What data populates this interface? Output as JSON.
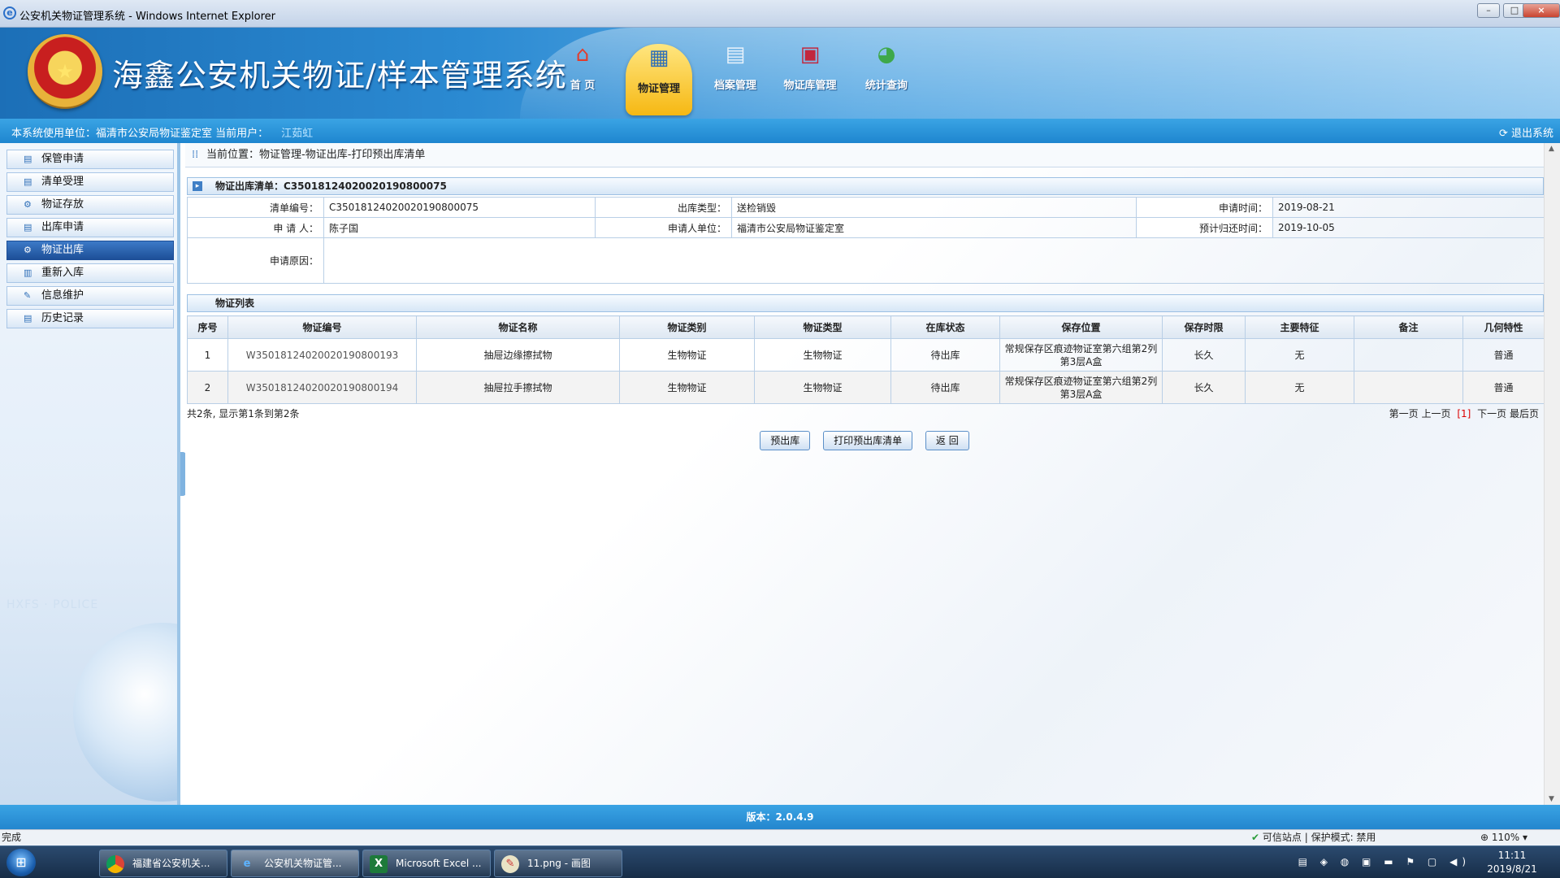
{
  "window": {
    "title": "公安机关物证管理系统 - Windows Internet Explorer"
  },
  "header": {
    "system_name": "海鑫公安机关物证/样本管理系统",
    "nav": [
      {
        "label": "首  页",
        "icon": "home-icon"
      },
      {
        "label": "物证管理",
        "icon": "calendar-icon"
      },
      {
        "label": "档案管理",
        "icon": "archive-icon"
      },
      {
        "label": "物证库管理",
        "icon": "warehouse-icon"
      },
      {
        "label": "统计查询",
        "icon": "chart-icon"
      }
    ],
    "active_nav": "物证管理"
  },
  "infobar": {
    "unit_text": "本系统使用单位：福清市公安局物证鉴定室 当前用户：",
    "user": "江茹虹",
    "logout": "退出系统"
  },
  "sidebar": {
    "items": [
      {
        "label": "保管申请"
      },
      {
        "label": "清单受理"
      },
      {
        "label": "物证存放"
      },
      {
        "label": "出库申请"
      },
      {
        "label": "物证出库"
      },
      {
        "label": "重新入库"
      },
      {
        "label": "信息维护"
      },
      {
        "label": "历史记录"
      }
    ],
    "active": "物证出库"
  },
  "breadcrumb": "当前位置：物证管理-物证出库-打印预出库清单",
  "detail": {
    "heading": "物证出库清单：C35018124020020190800075",
    "fields": {
      "list_no_label": "清单编号：",
      "list_no": "C35018124020020190800075",
      "out_type_label": "出库类型：",
      "out_type": "送检销毁",
      "apply_time_label": "申请时间：",
      "apply_time": "2019-08-21",
      "applicant_label": "申 请 人：",
      "applicant": "陈子国",
      "applicant_unit_label": "申请人单位：",
      "applicant_unit": "福清市公安局物证鉴定室",
      "return_time_label": "预计归还时间：",
      "return_time": "2019-10-05",
      "reason_label": "申请原因：",
      "reason": ""
    }
  },
  "evidence_list": {
    "heading": "物证列表",
    "columns": [
      "序号",
      "物证编号",
      "物证名称",
      "物证类别",
      "物证类型",
      "在库状态",
      "保存位置",
      "保存时限",
      "主要特征",
      "备注",
      "几何特性"
    ],
    "rows": [
      [
        "1",
        "W35018124020020190800193",
        "抽屉边缘擦拭物",
        "生物物证",
        "生物物证",
        "待出库",
        "常规保存区痕迹物证室第六组第2列第3层A盒",
        "长久",
        "无",
        "",
        "普通"
      ],
      [
        "2",
        "W35018124020020190800194",
        "抽屉拉手擦拭物",
        "生物物证",
        "生物物证",
        "待出库",
        "常规保存区痕迹物证室第六组第2列第3层A盒",
        "长久",
        "无",
        "",
        "普通"
      ]
    ],
    "summary": "共2条, 显示第1条到第2条",
    "pager": {
      "first": "第一页",
      "prev": "上一页",
      "current": "[1]",
      "next": "下一页",
      "last": "最后页"
    }
  },
  "buttons": {
    "pre_out": "预出库",
    "print": "打印预出库清单",
    "back": "返  回"
  },
  "footer": {
    "version": "版本：2.0.4.9"
  },
  "statusbar": {
    "left": "完成",
    "zone": "可信站点 | 保护模式: 禁用",
    "zoom": "110%"
  },
  "taskbar": {
    "items": [
      {
        "label": "福建省公安机关..."
      },
      {
        "label": "公安机关物证管..."
      },
      {
        "label": "Microsoft Excel ..."
      },
      {
        "label": "11.png - 画图"
      }
    ],
    "time": "11:11",
    "date": "2019/8/21"
  },
  "colors": {
    "banner": "#2b8ad2",
    "active_nav": "#f6b813",
    "sidebar_active": "#1d4f98",
    "pager_current": "#dd0000"
  }
}
